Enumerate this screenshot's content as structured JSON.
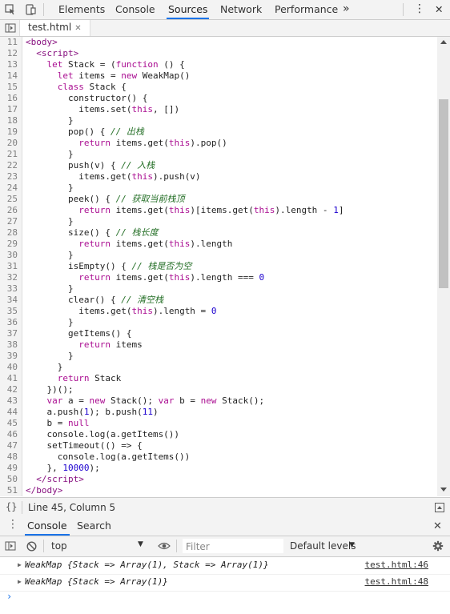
{
  "toolbar": {
    "tabs": [
      "Elements",
      "Console",
      "Sources",
      "Network",
      "Performance"
    ],
    "active_tab": "Sources",
    "more": "»",
    "kebab": "⋮",
    "close": "✕"
  },
  "file_tab": {
    "name": "test.html",
    "close": "✕"
  },
  "code_lines": [
    {
      "n": "11",
      "html": "<span class='tag'>&lt;body&gt;</span>"
    },
    {
      "n": "12",
      "html": "  <span class='tag'>&lt;script&gt;</span>"
    },
    {
      "n": "13",
      "html": "    <span class='kw'>let</span> Stack = (<span class='kw'>function</span> () {"
    },
    {
      "n": "14",
      "html": "      <span class='kw'>let</span> items = <span class='kw'>new</span> WeakMap()"
    },
    {
      "n": "15",
      "html": "      <span class='kw'>class</span> Stack {"
    },
    {
      "n": "16",
      "html": "        constructor() {"
    },
    {
      "n": "17",
      "html": "          items.set(<span class='kw'>this</span>, [])"
    },
    {
      "n": "18",
      "html": "        }"
    },
    {
      "n": "19",
      "html": "        pop() { <span class='cm'>// 出栈</span>"
    },
    {
      "n": "20",
      "html": "          <span class='kw'>return</span> items.get(<span class='kw'>this</span>).pop()"
    },
    {
      "n": "21",
      "html": "        }"
    },
    {
      "n": "22",
      "html": "        push(v) { <span class='cm'>// 入栈</span>"
    },
    {
      "n": "23",
      "html": "          items.get(<span class='kw'>this</span>).push(v)"
    },
    {
      "n": "24",
      "html": "        }"
    },
    {
      "n": "25",
      "html": "        peek() { <span class='cm'>// 获取当前栈顶</span>"
    },
    {
      "n": "26",
      "html": "          <span class='kw'>return</span> items.get(<span class='kw'>this</span>)[items.get(<span class='kw'>this</span>).length - <span class='num'>1</span>]"
    },
    {
      "n": "27",
      "html": "        }"
    },
    {
      "n": "28",
      "html": "        size() { <span class='cm'>// 栈长度</span>"
    },
    {
      "n": "29",
      "html": "          <span class='kw'>return</span> items.get(<span class='kw'>this</span>).length"
    },
    {
      "n": "30",
      "html": "        }"
    },
    {
      "n": "31",
      "html": "        isEmpty() { <span class='cm'>// 栈是否为空</span>"
    },
    {
      "n": "32",
      "html": "          <span class='kw'>return</span> items.get(<span class='kw'>this</span>).length === <span class='num'>0</span>"
    },
    {
      "n": "33",
      "html": "        }"
    },
    {
      "n": "34",
      "html": "        clear() { <span class='cm'>// 清空栈</span>"
    },
    {
      "n": "35",
      "html": "          items.get(<span class='kw'>this</span>).length = <span class='num'>0</span>"
    },
    {
      "n": "36",
      "html": "        }"
    },
    {
      "n": "37",
      "html": "        getItems() {"
    },
    {
      "n": "38",
      "html": "          <span class='kw'>return</span> items"
    },
    {
      "n": "39",
      "html": "        }"
    },
    {
      "n": "40",
      "html": "      }"
    },
    {
      "n": "41",
      "html": "      <span class='kw'>return</span> Stack"
    },
    {
      "n": "42",
      "html": "    })();"
    },
    {
      "n": "43",
      "html": "    <span class='kw'>var</span> a = <span class='kw'>new</span> Stack(); <span class='kw'>var</span> b = <span class='kw'>new</span> Stack();"
    },
    {
      "n": "44",
      "html": "    a.push(<span class='num'>1</span>); b.push(<span class='num'>11</span>)"
    },
    {
      "n": "45",
      "html": "    b = <span class='kw'>null</span>"
    },
    {
      "n": "46",
      "html": "    console.log(a.getItems())"
    },
    {
      "n": "47",
      "html": "    setTimeout(() =&gt; {"
    },
    {
      "n": "48",
      "html": "      console.log(a.getItems())"
    },
    {
      "n": "49",
      "html": "    }, <span class='num'>10000</span>);"
    },
    {
      "n": "50",
      "html": "  <span class='tag'>&lt;/script&gt;</span>"
    },
    {
      "n": "51",
      "html": "<span class='tag'>&lt;/body&gt;</span>"
    }
  ],
  "status": {
    "position": "Line 45, Column 5",
    "braces": "{}"
  },
  "drawer": {
    "tabs": [
      "Console",
      "Search"
    ],
    "active": "Console",
    "close": "✕"
  },
  "console_toolbar": {
    "context": "top",
    "filter_placeholder": "Filter",
    "levels": "Default levels"
  },
  "messages": [
    {
      "text": "WeakMap {Stack => Array(1), Stack => Array(1)}",
      "source": "test.html:46"
    },
    {
      "text": "WeakMap {Stack => Array(1)}",
      "source": "test.html:48"
    }
  ],
  "prompt": "›"
}
